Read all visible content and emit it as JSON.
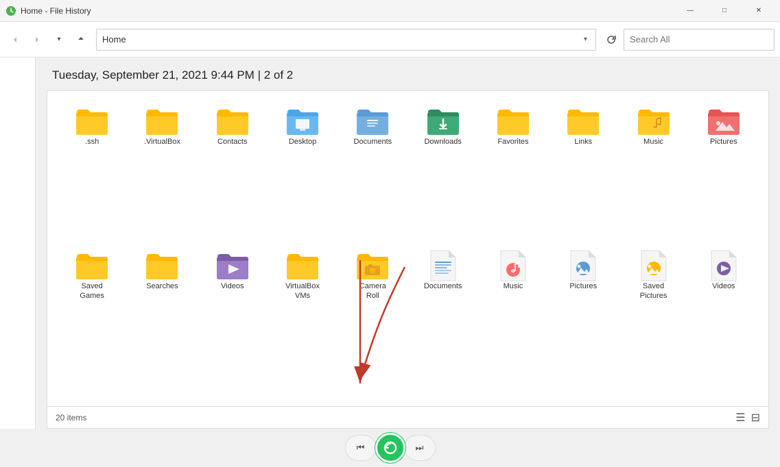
{
  "titleBar": {
    "title": "Home - File History",
    "minimize": "—",
    "maximize": "□",
    "close": "✕"
  },
  "navBar": {
    "back": "←",
    "forward": "→",
    "up": "↑",
    "address": "Home",
    "addressPlaceholder": "Home",
    "searchPlaceholder": "Search All",
    "refresh": "↻"
  },
  "dateHeader": "Tuesday, September 21, 2021 9:44 PM  |  2 of 2",
  "statusBar": {
    "itemCount": "20 items"
  },
  "fileItems": [
    {
      "label": ".ssh",
      "type": "folder-plain"
    },
    {
      "label": ".VirtualBox",
      "type": "folder-plain"
    },
    {
      "label": "Contacts",
      "type": "folder-plain"
    },
    {
      "label": "Desktop",
      "type": "folder-desktop"
    },
    {
      "label": "Documents",
      "type": "folder-documents"
    },
    {
      "label": "Downloads",
      "type": "folder-downloads"
    },
    {
      "label": "Favorites",
      "type": "folder-plain"
    },
    {
      "label": "Links",
      "type": "folder-plain"
    },
    {
      "label": "Music",
      "type": "folder-music"
    },
    {
      "label": "Pictures",
      "type": "folder-pictures"
    },
    {
      "label": "Saved\nGames",
      "type": "folder-plain"
    },
    {
      "label": "Searches",
      "type": "folder-plain"
    },
    {
      "label": "Videos",
      "type": "folder-videos"
    },
    {
      "label": "VirtualBox\nVMs",
      "type": "folder-plain"
    },
    {
      "label": "Camera\nRoll",
      "type": "folder-camera"
    },
    {
      "label": "Documents",
      "type": "doc-file"
    },
    {
      "label": "Music",
      "type": "music-file"
    },
    {
      "label": "Pictures",
      "type": "pic-file"
    },
    {
      "label": "Saved\nPictures",
      "type": "saved-pic-file"
    },
    {
      "label": "Videos",
      "type": "video-file"
    }
  ],
  "playerControls": {
    "prevLabel": "⏮",
    "playLabel": "↺",
    "nextLabel": "⏭"
  }
}
